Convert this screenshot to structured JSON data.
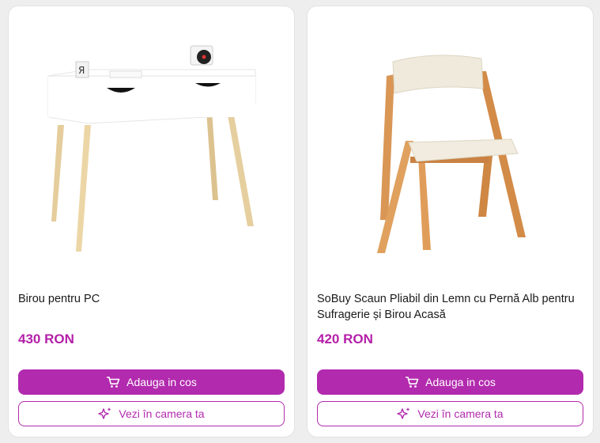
{
  "colors": {
    "accent": "#b22aae",
    "price": "#b41fa8"
  },
  "products": [
    {
      "title": "Birou pentru PC",
      "price": "430 RON",
      "cart_label": "Adauga in cos",
      "ar_label": "Vezi în camera ta",
      "image_icon": "desk-image"
    },
    {
      "title": "SoBuy Scaun Pliabil din Lemn cu Pernă Alb pentru Sufragerie și Birou Acasă",
      "price": "420 RON",
      "cart_label": "Adauga in cos",
      "ar_label": "Vezi în camera ta",
      "image_icon": "chair-image"
    }
  ]
}
